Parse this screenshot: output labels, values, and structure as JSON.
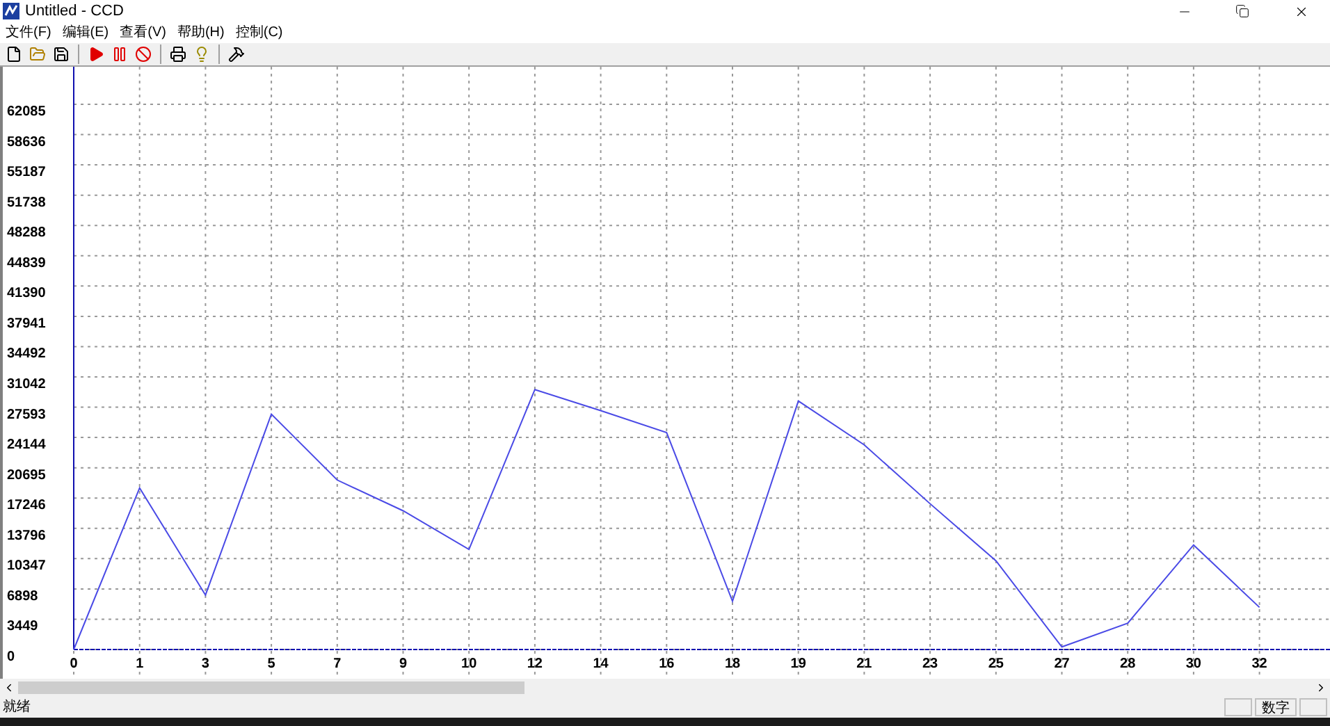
{
  "window": {
    "title": "Untitled - CCD"
  },
  "menu": [
    "文件(F)",
    "编辑(E)",
    "查看(V)",
    "帮助(H)",
    "控制(C)"
  ],
  "chart": {
    "chart_data": {
      "type": "line",
      "categories": [
        "0",
        "1",
        "3",
        "5",
        "7",
        "9",
        "10",
        "12",
        "14",
        "16",
        "18",
        "19",
        "21",
        "23",
        "25",
        "27",
        "28",
        "30",
        "32"
      ],
      "grid": true,
      "series": [
        {
          "color": "#4a4ae6",
          "values": [
            0,
            18400,
            6200,
            26800,
            19300,
            15800,
            11400,
            29600,
            27200,
            24700,
            5500,
            28300,
            23300,
            16600,
            10100,
            300,
            3000,
            11900,
            4800
          ]
        }
      ],
      "ylim": [
        0,
        62085
      ],
      "yticks": [
        0,
        3449,
        6898,
        10347,
        13796,
        17246,
        20695,
        24144,
        27593,
        31042,
        34492,
        37941,
        41390,
        44839,
        48288,
        51738,
        55187,
        58636,
        62085
      ]
    }
  },
  "status_bar": {
    "message": "就绪",
    "panes": [
      "数字"
    ]
  }
}
